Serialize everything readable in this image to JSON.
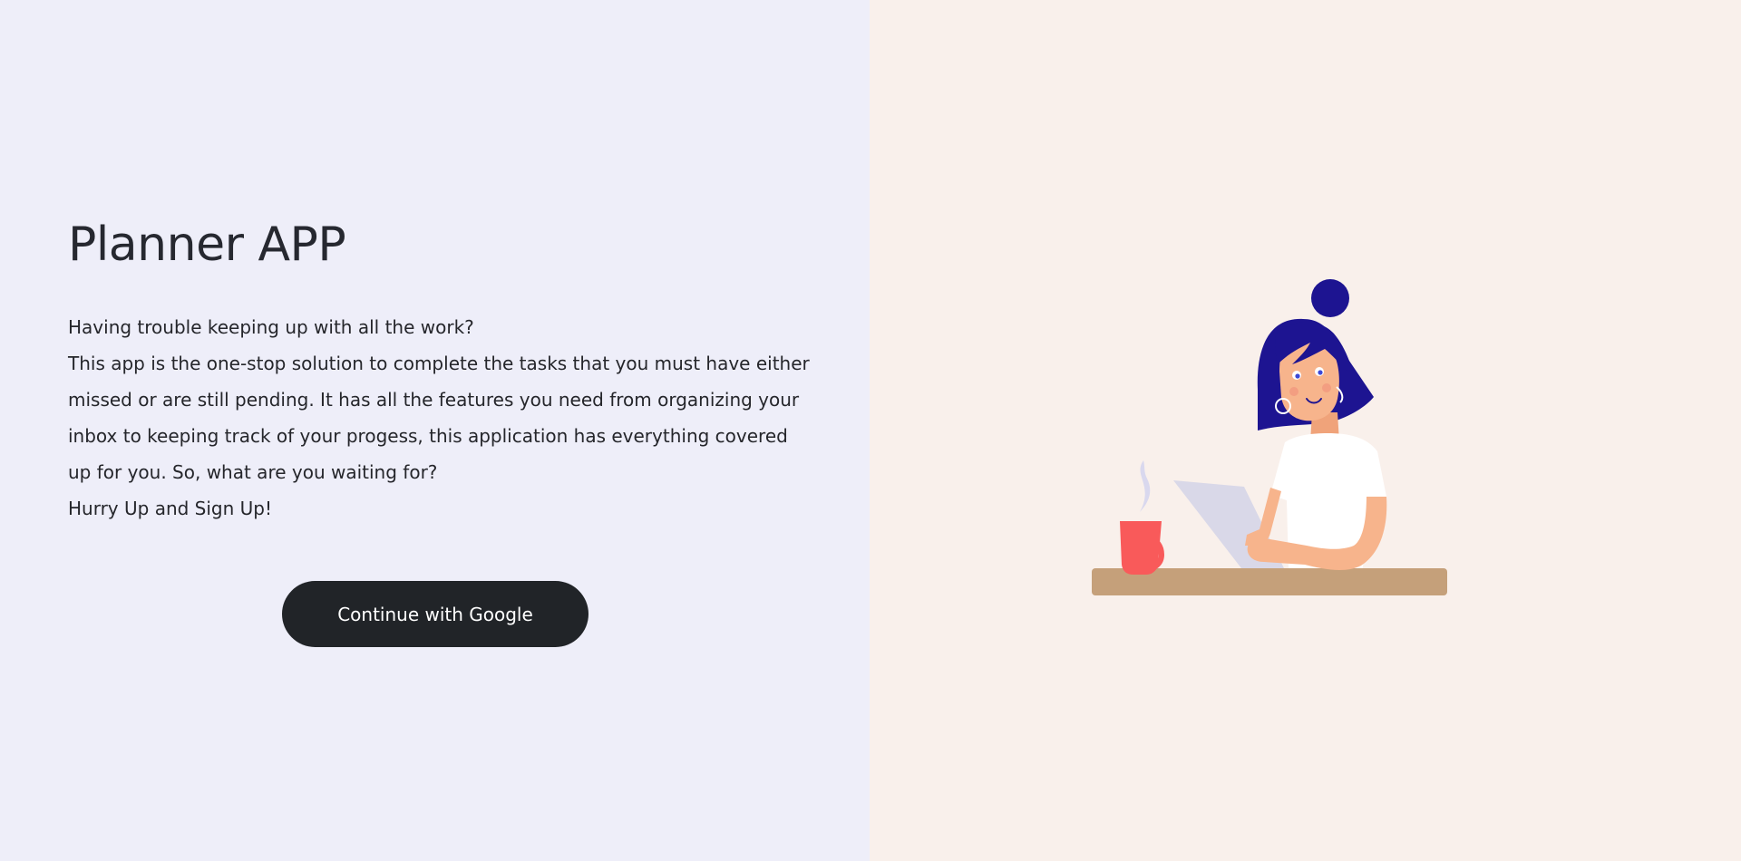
{
  "app": {
    "title": "Planner APP"
  },
  "intro": {
    "line1": "Having trouble keeping up with all the work?",
    "paragraph": "This app is the one-stop solution to complete the tasks that you must have either missed or are still pending. It has all the features you need from organizing your inbox to keeping track of your progess, this application has everything covered up for you. So, what are you waiting for?",
    "cta_text": "Hurry Up and Sign Up!"
  },
  "auth": {
    "google_button_label": "Continue with Google"
  },
  "colors": {
    "left_panel_bg": "#eeeef9",
    "right_panel_bg": "#f9f0eb",
    "button_bg": "#212428",
    "hair": "#1d1491",
    "skin": "#f7b48c",
    "mug": "#f95a5a",
    "desk": "#c5a07a"
  },
  "illustration": {
    "icon": "woman-at-desk-with-coffee-illustration"
  }
}
